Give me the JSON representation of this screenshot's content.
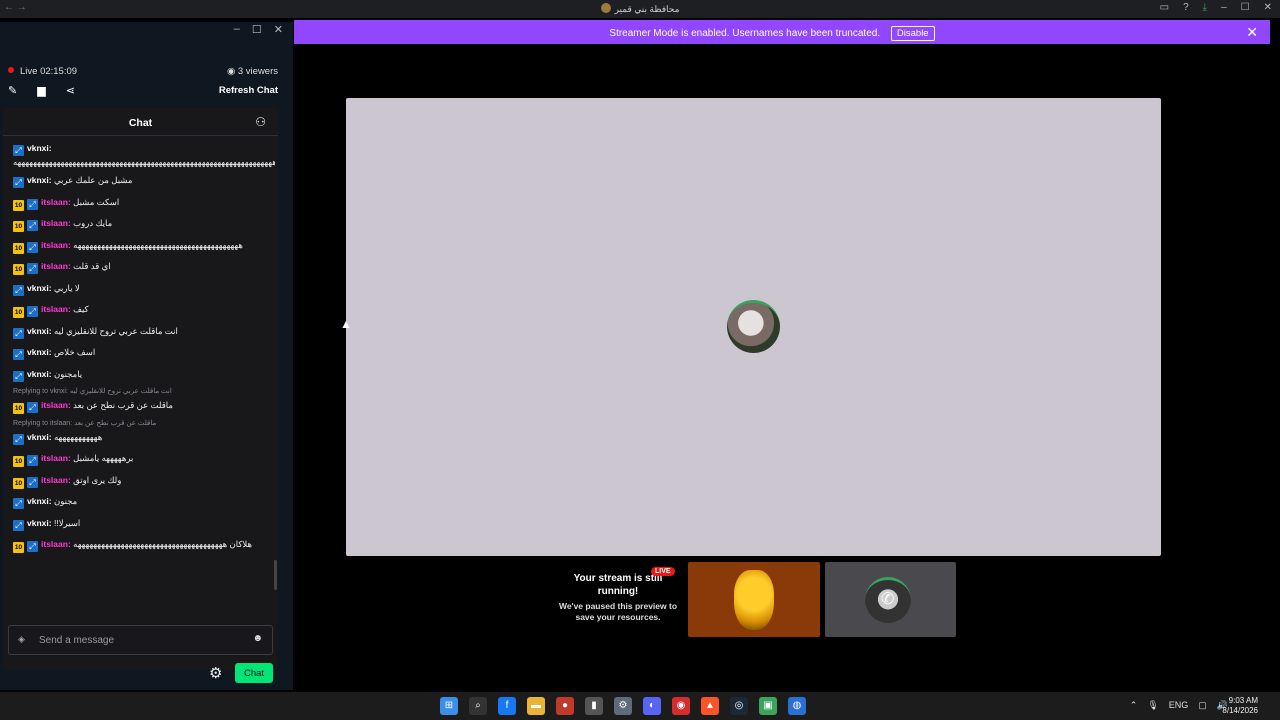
{
  "titlebar": {
    "title": "محافظة بني قمير",
    "back": "←",
    "forward": "→",
    "icons": [
      "inbox-icon",
      "help-icon",
      "download-icon"
    ],
    "min": "–",
    "max": "☐",
    "close": "✕"
  },
  "banner": {
    "text": "Streamer Mode is enabled. Usernames have been truncated.",
    "button": "Disable",
    "close": "✕",
    "color": "#9147ff"
  },
  "popout": {
    "min": "–",
    "max": "☐",
    "close": "✕",
    "live_label": "Live 02:15:09",
    "viewers": "3 viewers",
    "refresh": "Refresh Chat"
  },
  "chat": {
    "title": "Chat",
    "messages": [
      {
        "sub": "",
        "user": "vknxi",
        "text": "ههههههههههههههههههههههههههههههههههههههههههههههههههههههههههههههههههه"
      },
      {
        "sub": "",
        "user": "vknxi",
        "text": "مشبل من علمك عربي"
      },
      {
        "sub": "10",
        "user": "itslaan",
        "text": "اسكت مشبل"
      },
      {
        "sub": "10",
        "user": "itslaan",
        "text": "مايك دروب"
      },
      {
        "sub": "10",
        "user": "itslaan",
        "text": "ههههههههههههههههههههههههههههههههههههههههههه"
      },
      {
        "sub": "10",
        "user": "itslaan",
        "text": "اي قد قلت"
      },
      {
        "sub": "",
        "user": "vknxi",
        "text": "لا ياربي"
      },
      {
        "sub": "10",
        "user": "itslaan",
        "text": "كيف"
      },
      {
        "sub": "",
        "user": "vknxi",
        "text": "انت ماقلت عربي تروح للانقليزي ليه"
      },
      {
        "sub": "",
        "user": "vknxi",
        "text": "اسف خلاص"
      },
      {
        "sub": "",
        "user": "vknxi",
        "text": "يامجنون"
      },
      {
        "reply": "Replying to vknxi: انت ماقلت عربي تروح للانقليزي ليه",
        "sub": "10",
        "user": "itslaan",
        "text": "ماقلت عن قرب نطح عن بعد"
      },
      {
        "reply": "Replying to itslaan: ماقلت عن قرب نطح عن بعد",
        "sub": "",
        "user": "vknxi",
        "text": "هههههههههههه"
      },
      {
        "sub": "10",
        "user": "itslaan",
        "text": "برهههههه يامشبل"
      },
      {
        "sub": "10",
        "user": "itslaan",
        "text": "ولك يرى اوتق"
      },
      {
        "sub": "",
        "user": "vknxi",
        "text": "مجنون"
      },
      {
        "sub": "",
        "user": "vknxi",
        "text": "!!اسيرلا"
      },
      {
        "sub": "10",
        "user": "itslaan",
        "text": "هلاكان ههههههههههههههههههههههههههههههههههههههه"
      }
    ],
    "input_placeholder": "Send a message",
    "send_label": "Chat",
    "colors": {
      "vknxi": "#ffffff",
      "itslaan": "#ff3bd4",
      "send_button": "#00e676"
    }
  },
  "stream_panel": {
    "still_title": "Your stream is still running!",
    "still_sub": "We've paused this preview to save your resources.",
    "live_tag": "LIVE"
  },
  "taskbar": {
    "icons": [
      "windows-icon",
      "search-icon",
      "facebook-icon",
      "file-explorer-icon",
      "app-icon",
      "mic-app-icon",
      "settings-icon",
      "discord-icon",
      "record-icon",
      "brave-icon",
      "steam-icon",
      "active-app-icon",
      "ea-icon"
    ],
    "lang": "ENG",
    "time": "9:03 AM",
    "date": "8/14/2026"
  }
}
